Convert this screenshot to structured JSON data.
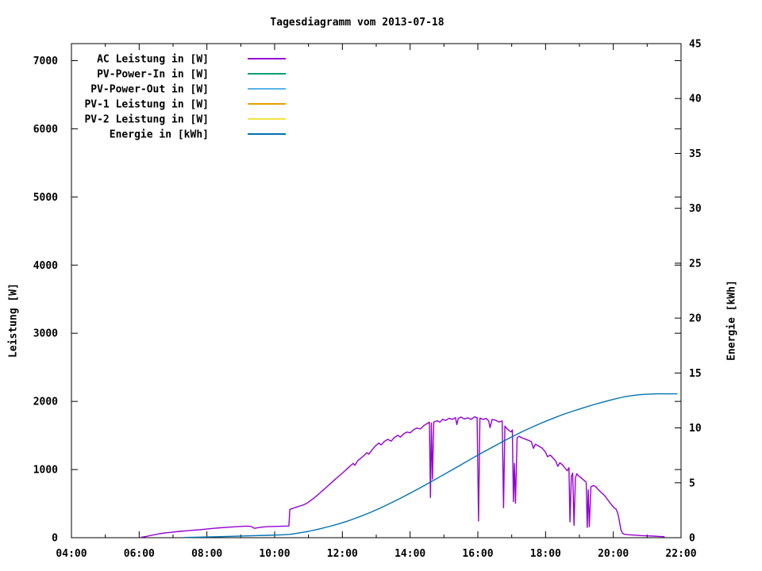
{
  "chart_data": {
    "type": "line",
    "title": "Tagesdiagramm vom 2013-07-18",
    "x_axis": {
      "range_hours": [
        4,
        22
      ],
      "major_tick_hours": [
        4,
        6,
        8,
        10,
        12,
        14,
        16,
        18,
        20,
        22
      ],
      "major_tick_labels": [
        "04:00",
        "06:00",
        "08:00",
        "10:00",
        "12:00",
        "14:00",
        "16:00",
        "18:00",
        "20:00",
        "22:00"
      ],
      "minor_tick_hours": [
        5,
        7,
        9,
        11,
        13,
        15,
        17,
        19,
        21
      ],
      "grid": false
    },
    "y_axis_left": {
      "title": "Leistung [W]",
      "range": [
        0,
        7250
      ],
      "tick_values": [
        0,
        1000,
        2000,
        3000,
        4000,
        5000,
        6000,
        7000
      ],
      "tick_labels": [
        "0",
        "1000",
        "2000",
        "3000",
        "4000",
        "5000",
        "6000",
        "7000"
      ]
    },
    "y_axis_right": {
      "title": "Energie [kWh]",
      "range": [
        0,
        45
      ],
      "tick_values": [
        0,
        5,
        10,
        15,
        20,
        25,
        30,
        35,
        40,
        45
      ],
      "tick_labels": [
        "0",
        "5",
        "10",
        "15",
        "20",
        "25",
        "30",
        "35",
        "40",
        "45"
      ]
    },
    "legend": {
      "position": "top-left-inside",
      "entries": [
        {
          "label": "AC Leistung in [W]",
          "color": "#9400d3"
        },
        {
          "label": "PV-Power-In in [W]",
          "color": "#009e73"
        },
        {
          "label": "PV-Power-Out in [W]",
          "color": "#56b4e9"
        },
        {
          "label": "PV-1 Leistung in [W]",
          "color": "#e69f00"
        },
        {
          "label": "PV-2 Leistung in [W]",
          "color": "#f0e442"
        },
        {
          "label": "Energie in [kWh]",
          "color": "#0072b2"
        }
      ]
    },
    "series": [
      {
        "name": "AC Leistung in [W]",
        "axis": "left",
        "color": "#9400d3",
        "points": [
          [
            6.05,
            5
          ],
          [
            6.2,
            18
          ],
          [
            6.4,
            38
          ],
          [
            6.6,
            58
          ],
          [
            6.8,
            72
          ],
          [
            7.0,
            83
          ],
          [
            7.2,
            93
          ],
          [
            7.4,
            101
          ],
          [
            7.6,
            109
          ],
          [
            7.8,
            117
          ],
          [
            8.0,
            127
          ],
          [
            8.2,
            137
          ],
          [
            8.4,
            146
          ],
          [
            8.6,
            153
          ],
          [
            8.8,
            159
          ],
          [
            9.0,
            165
          ],
          [
            9.15,
            170
          ],
          [
            9.3,
            166
          ],
          [
            9.4,
            137
          ],
          [
            9.5,
            147
          ],
          [
            9.65,
            156
          ],
          [
            9.8,
            162
          ],
          [
            10.0,
            165
          ],
          [
            10.2,
            167
          ],
          [
            10.42,
            171
          ],
          [
            10.45,
            415
          ],
          [
            10.55,
            432
          ],
          [
            10.65,
            450
          ],
          [
            10.75,
            465
          ],
          [
            10.85,
            482
          ],
          [
            10.95,
            505
          ],
          [
            11.05,
            540
          ],
          [
            11.15,
            578
          ],
          [
            11.25,
            618
          ],
          [
            11.35,
            662
          ],
          [
            11.45,
            706
          ],
          [
            11.55,
            750
          ],
          [
            11.65,
            795
          ],
          [
            11.75,
            840
          ],
          [
            11.85,
            883
          ],
          [
            11.95,
            925
          ],
          [
            12.05,
            970
          ],
          [
            12.15,
            1015
          ],
          [
            12.25,
            1060
          ],
          [
            12.32,
            1090
          ],
          [
            12.37,
            1062
          ],
          [
            12.45,
            1128
          ],
          [
            12.55,
            1168
          ],
          [
            12.65,
            1212
          ],
          [
            12.72,
            1248
          ],
          [
            12.78,
            1225
          ],
          [
            12.88,
            1290
          ],
          [
            12.98,
            1348
          ],
          [
            13.08,
            1390
          ],
          [
            13.14,
            1362
          ],
          [
            13.24,
            1412
          ],
          [
            13.34,
            1443
          ],
          [
            13.44,
            1416
          ],
          [
            13.54,
            1472
          ],
          [
            13.64,
            1502
          ],
          [
            13.71,
            1476
          ],
          [
            13.81,
            1525
          ],
          [
            13.91,
            1550
          ],
          [
            14.0,
            1538
          ],
          [
            14.1,
            1583
          ],
          [
            14.2,
            1610
          ],
          [
            14.3,
            1596
          ],
          [
            14.4,
            1642
          ],
          [
            14.5,
            1675
          ],
          [
            14.57,
            1696
          ],
          [
            14.6,
            590
          ],
          [
            14.63,
            1682
          ],
          [
            14.66,
            860
          ],
          [
            14.7,
            1698
          ],
          [
            14.8,
            1716
          ],
          [
            14.88,
            1696
          ],
          [
            14.96,
            1738
          ],
          [
            15.05,
            1720
          ],
          [
            15.15,
            1752
          ],
          [
            15.25,
            1736
          ],
          [
            15.34,
            1762
          ],
          [
            15.38,
            1660
          ],
          [
            15.42,
            1748
          ],
          [
            15.5,
            1770
          ],
          [
            15.6,
            1742
          ],
          [
            15.7,
            1758
          ],
          [
            15.8,
            1736
          ],
          [
            15.9,
            1772
          ],
          [
            15.98,
            1762
          ],
          [
            16.02,
            244
          ],
          [
            16.06,
            1755
          ],
          [
            16.15,
            1736
          ],
          [
            16.25,
            1750
          ],
          [
            16.32,
            1712
          ],
          [
            16.36,
            1615
          ],
          [
            16.42,
            1735
          ],
          [
            16.52,
            1725
          ],
          [
            16.62,
            1698
          ],
          [
            16.72,
            1712
          ],
          [
            16.76,
            440
          ],
          [
            16.8,
            1638
          ],
          [
            16.86,
            1598
          ],
          [
            16.92,
            1572
          ],
          [
            16.98,
            1552
          ],
          [
            17.02,
            1582
          ],
          [
            17.05,
            530
          ],
          [
            17.08,
            1090
          ],
          [
            17.11,
            505
          ],
          [
            17.16,
            1468
          ],
          [
            17.22,
            1488
          ],
          [
            17.3,
            1465
          ],
          [
            17.4,
            1447
          ],
          [
            17.5,
            1428
          ],
          [
            17.58,
            1408
          ],
          [
            17.64,
            1312
          ],
          [
            17.7,
            1372
          ],
          [
            17.8,
            1344
          ],
          [
            17.9,
            1314
          ],
          [
            18.0,
            1255
          ],
          [
            18.06,
            1188
          ],
          [
            18.14,
            1212
          ],
          [
            18.22,
            1170
          ],
          [
            18.3,
            1125
          ],
          [
            18.36,
            1047
          ],
          [
            18.42,
            1098
          ],
          [
            18.5,
            1068
          ],
          [
            18.58,
            1018
          ],
          [
            18.64,
            982
          ],
          [
            18.69,
            1028
          ],
          [
            18.72,
            232
          ],
          [
            18.76,
            902
          ],
          [
            18.8,
            948
          ],
          [
            18.84,
            180
          ],
          [
            18.88,
            872
          ],
          [
            18.92,
            938
          ],
          [
            18.98,
            905
          ],
          [
            19.05,
            878
          ],
          [
            19.1,
            856
          ],
          [
            19.15,
            835
          ],
          [
            19.2,
            815
          ],
          [
            19.23,
            150
          ],
          [
            19.26,
            700
          ],
          [
            19.29,
            162
          ],
          [
            19.34,
            748
          ],
          [
            19.42,
            766
          ],
          [
            19.5,
            740
          ],
          [
            19.56,
            702
          ],
          [
            19.65,
            662
          ],
          [
            19.75,
            614
          ],
          [
            19.85,
            546
          ],
          [
            19.95,
            482
          ],
          [
            20.03,
            438
          ],
          [
            20.08,
            420
          ],
          [
            20.13,
            362
          ],
          [
            20.17,
            272
          ],
          [
            20.22,
            122
          ],
          [
            20.27,
            65
          ],
          [
            20.33,
            50
          ],
          [
            20.45,
            43
          ],
          [
            20.6,
            38
          ],
          [
            20.8,
            32
          ],
          [
            21.0,
            27
          ],
          [
            21.2,
            23
          ],
          [
            21.35,
            19
          ],
          [
            21.5,
            15
          ]
        ]
      },
      {
        "name": "Energie in [kWh]",
        "axis": "right",
        "color": "#0072b2",
        "points": [
          [
            7.33,
            0.02
          ],
          [
            7.8,
            0.05
          ],
          [
            8.3,
            0.09
          ],
          [
            8.8,
            0.13
          ],
          [
            9.3,
            0.17
          ],
          [
            9.8,
            0.22
          ],
          [
            10.2,
            0.26
          ],
          [
            10.45,
            0.3
          ],
          [
            10.7,
            0.42
          ],
          [
            11.0,
            0.58
          ],
          [
            11.3,
            0.78
          ],
          [
            11.6,
            1.01
          ],
          [
            11.9,
            1.27
          ],
          [
            12.2,
            1.56
          ],
          [
            12.5,
            1.9
          ],
          [
            12.8,
            2.27
          ],
          [
            13.1,
            2.67
          ],
          [
            13.4,
            3.11
          ],
          [
            13.7,
            3.57
          ],
          [
            14.0,
            4.05
          ],
          [
            14.3,
            4.55
          ],
          [
            14.6,
            5.06
          ],
          [
            14.9,
            5.58
          ],
          [
            15.2,
            6.11
          ],
          [
            15.5,
            6.64
          ],
          [
            15.8,
            7.17
          ],
          [
            16.1,
            7.69
          ],
          [
            16.4,
            8.2
          ],
          [
            16.7,
            8.7
          ],
          [
            17.0,
            9.18
          ],
          [
            17.3,
            9.64
          ],
          [
            17.6,
            10.07
          ],
          [
            17.9,
            10.47
          ],
          [
            18.2,
            10.85
          ],
          [
            18.5,
            11.2
          ],
          [
            18.8,
            11.52
          ],
          [
            19.1,
            11.82
          ],
          [
            19.4,
            12.1
          ],
          [
            19.7,
            12.36
          ],
          [
            20.0,
            12.6
          ],
          [
            20.2,
            12.75
          ],
          [
            20.4,
            12.87
          ],
          [
            20.6,
            12.96
          ],
          [
            20.8,
            13.03
          ],
          [
            21.0,
            13.07
          ],
          [
            21.3,
            13.1
          ],
          [
            21.88,
            13.1
          ]
        ]
      }
    ]
  }
}
